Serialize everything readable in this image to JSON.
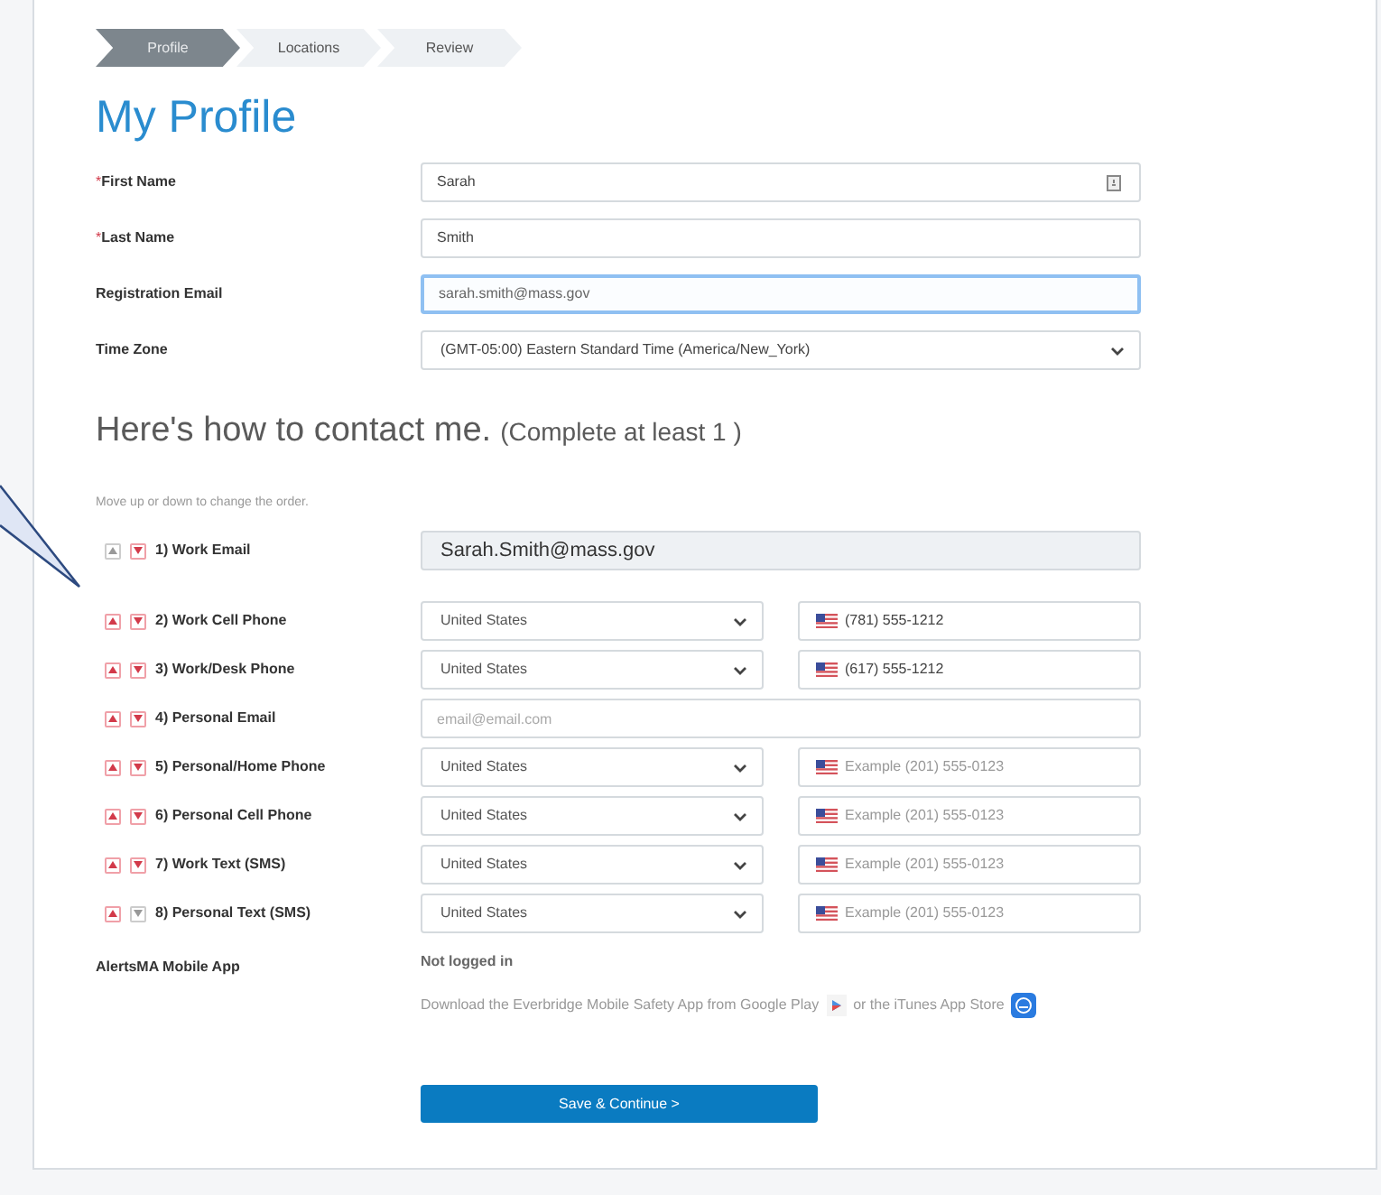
{
  "steps": [
    {
      "label": "Profile",
      "selected": true
    },
    {
      "label": "Locations",
      "selected": false
    },
    {
      "label": "Review",
      "selected": false
    }
  ],
  "title": "My Profile",
  "profile_fields": [
    {
      "kind": "text",
      "label": "First Name",
      "required": true,
      "value": "Sarah",
      "focused": false,
      "contact_icon": true
    },
    {
      "kind": "text",
      "label": "Last Name",
      "required": true,
      "value": "Smith",
      "focused": false
    },
    {
      "kind": "text",
      "label": "Registration Email",
      "required": false,
      "value": "sarah.smith@mass.gov",
      "focused": true
    },
    {
      "kind": "select",
      "label": "Time Zone",
      "required": false,
      "value": "(GMT-05:00) Eastern Standard Time (America/New_York)"
    }
  ],
  "required_mark": "*",
  "contact_heading": "Here's how to contact me.",
  "contact_note": "(Complete at least 1 )",
  "order_hint": "Move up or down to change the order.",
  "contacts": [
    {
      "kind": "locked_email",
      "label": "1) Work Email",
      "up_disabled": true,
      "down_disabled": false,
      "value": "Sarah.Smith@mass.gov"
    },
    {
      "kind": "phone",
      "label": "2) Work Cell Phone",
      "up_disabled": false,
      "down_disabled": false,
      "country": "United States",
      "value": "(781) 555-1212"
    },
    {
      "kind": "phone",
      "label": "3) Work/Desk Phone",
      "up_disabled": false,
      "down_disabled": false,
      "country": "United States",
      "value": "(617) 555-1212"
    },
    {
      "kind": "email",
      "label": "4) Personal Email",
      "up_disabled": false,
      "down_disabled": false,
      "placeholder": "email@email.com"
    },
    {
      "kind": "phone",
      "label": "5) Personal/Home Phone",
      "up_disabled": false,
      "down_disabled": false,
      "country": "United States",
      "placeholder": "Example (201) 555-0123"
    },
    {
      "kind": "phone",
      "label": "6) Personal Cell Phone",
      "up_disabled": false,
      "down_disabled": false,
      "country": "United States",
      "placeholder": "Example (201) 555-0123"
    },
    {
      "kind": "phone",
      "label": "7) Work Text (SMS)",
      "up_disabled": false,
      "down_disabled": false,
      "country": "United States",
      "placeholder": "Example (201) 555-0123"
    },
    {
      "kind": "phone",
      "label": "8) Personal Text (SMS)",
      "up_disabled": false,
      "down_disabled": true,
      "country": "United States",
      "placeholder": "Example (201) 555-0123"
    }
  ],
  "mobile_app": {
    "label": "AlertsMA Mobile App",
    "status": "Not logged in",
    "download_text": "Download the Everbridge Mobile Safety App from Google Play",
    "download_text_2": "or the iTunes App Store"
  },
  "save_button": "Save & Continue >"
}
